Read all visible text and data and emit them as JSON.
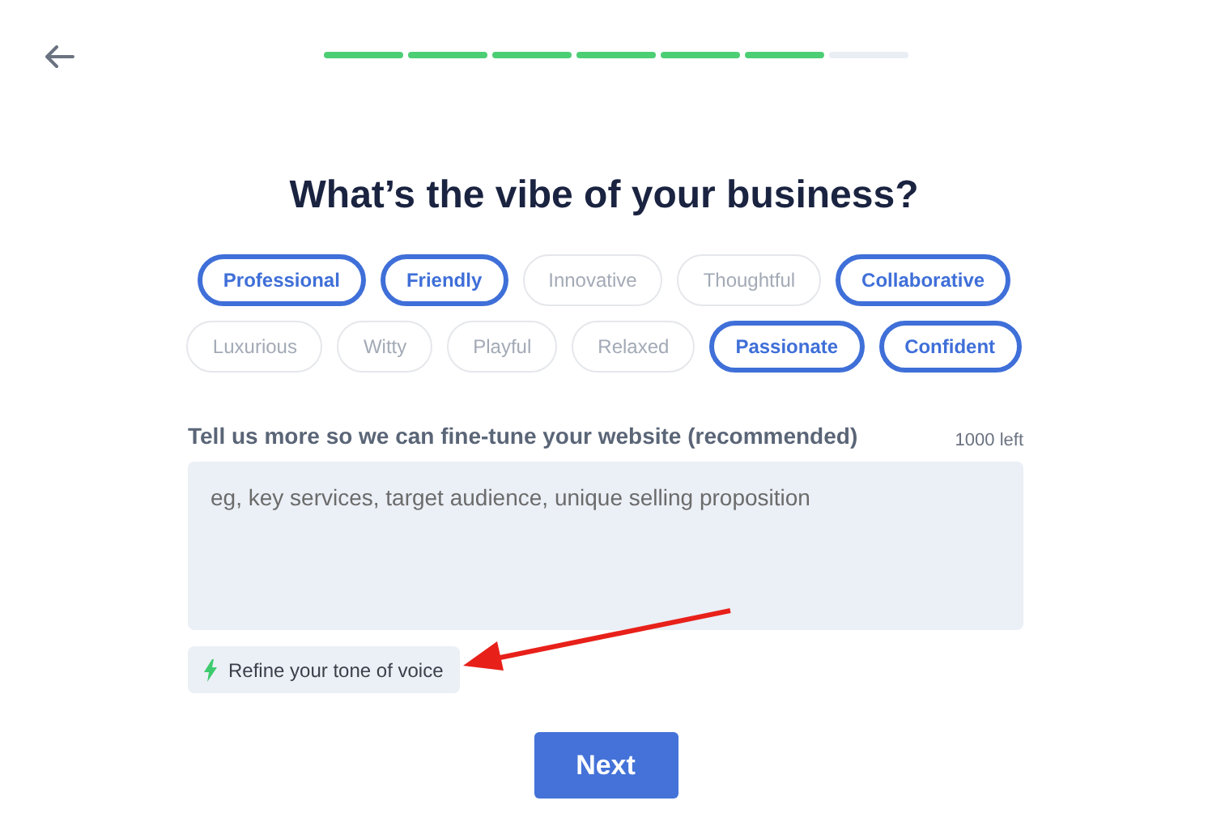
{
  "progress": [
    {
      "done": true
    },
    {
      "done": true
    },
    {
      "done": true
    },
    {
      "done": true
    },
    {
      "done": true
    },
    {
      "done": true
    },
    {
      "done": false
    }
  ],
  "title": "What’s the vibe of your business?",
  "tone_rows": [
    [
      {
        "label": "Professional",
        "selected": true
      },
      {
        "label": "Friendly",
        "selected": true
      },
      {
        "label": "Innovative",
        "selected": false
      },
      {
        "label": "Thoughtful",
        "selected": false
      },
      {
        "label": "Collaborative",
        "selected": true
      }
    ],
    [
      {
        "label": "Luxurious",
        "selected": false
      },
      {
        "label": "Witty",
        "selected": false
      },
      {
        "label": "Playful",
        "selected": false
      },
      {
        "label": "Relaxed",
        "selected": false
      },
      {
        "label": "Passionate",
        "selected": true
      },
      {
        "label": "Confident",
        "selected": true
      }
    ]
  ],
  "details": {
    "label": "Tell us more so we can fine-tune your website (recommended)",
    "counter": "1000 left",
    "placeholder": "eg, key services, target audience, unique selling proposition"
  },
  "refine_button": "Refine your tone of voice",
  "next_button": "Next"
}
